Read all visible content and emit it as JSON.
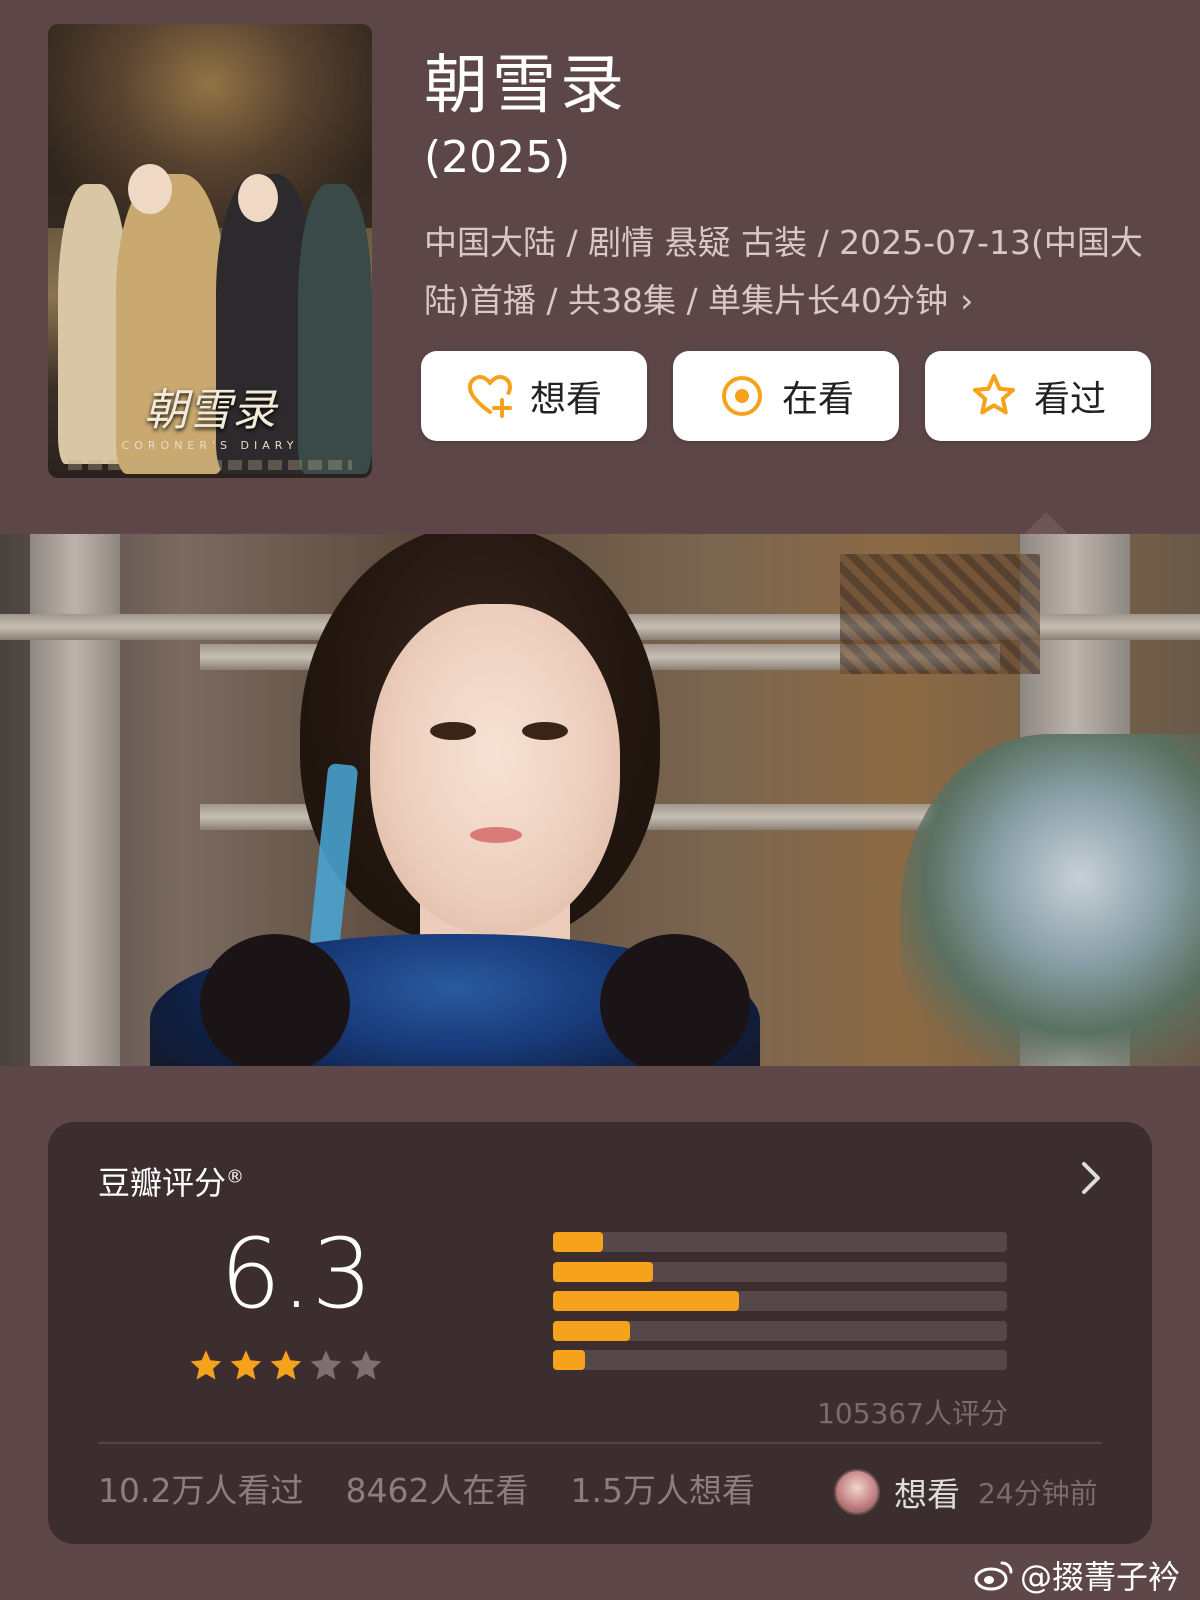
{
  "show": {
    "title": "朝雪录",
    "year": "(2025)",
    "meta": "中国大陆 / 剧情 悬疑 古装 / 2025-07-13(中国大陆)首播 / 共38集 / 单集片长40分钟",
    "meta_chevron": "›",
    "poster": {
      "title_art": "朝雪录",
      "subtitle_art": "CORONER'S DIARY"
    }
  },
  "actions": [
    {
      "label": "想看",
      "icon": "heart-plus-icon"
    },
    {
      "label": "在看",
      "icon": "target-icon"
    },
    {
      "label": "看过",
      "icon": "star-outline-icon"
    }
  ],
  "rating": {
    "heading": "豆瓣评分",
    "heading_mark": "®",
    "score": "6.3",
    "stars_filled": 3,
    "stars_total": 5,
    "distribution": [
      {
        "stars": 5,
        "fraction": 0.11
      },
      {
        "stars": 4,
        "fraction": 0.22
      },
      {
        "stars": 3,
        "fraction": 0.41
      },
      {
        "stars": 2,
        "fraction": 0.17
      },
      {
        "stars": 1,
        "fraction": 0.07
      }
    ],
    "count_text": "105367人评分",
    "stats": [
      "10.2万人看过",
      "8462人在看",
      "1.5万人想看"
    ],
    "activity": {
      "action": "想看",
      "time": "24分钟前"
    }
  },
  "watermark": "@掇菁子衿",
  "colors": {
    "accent": "#f7a21b",
    "star_empty": "#7e7072",
    "header_bg": "#5d4648",
    "card_bg": "#3c2d2f"
  }
}
